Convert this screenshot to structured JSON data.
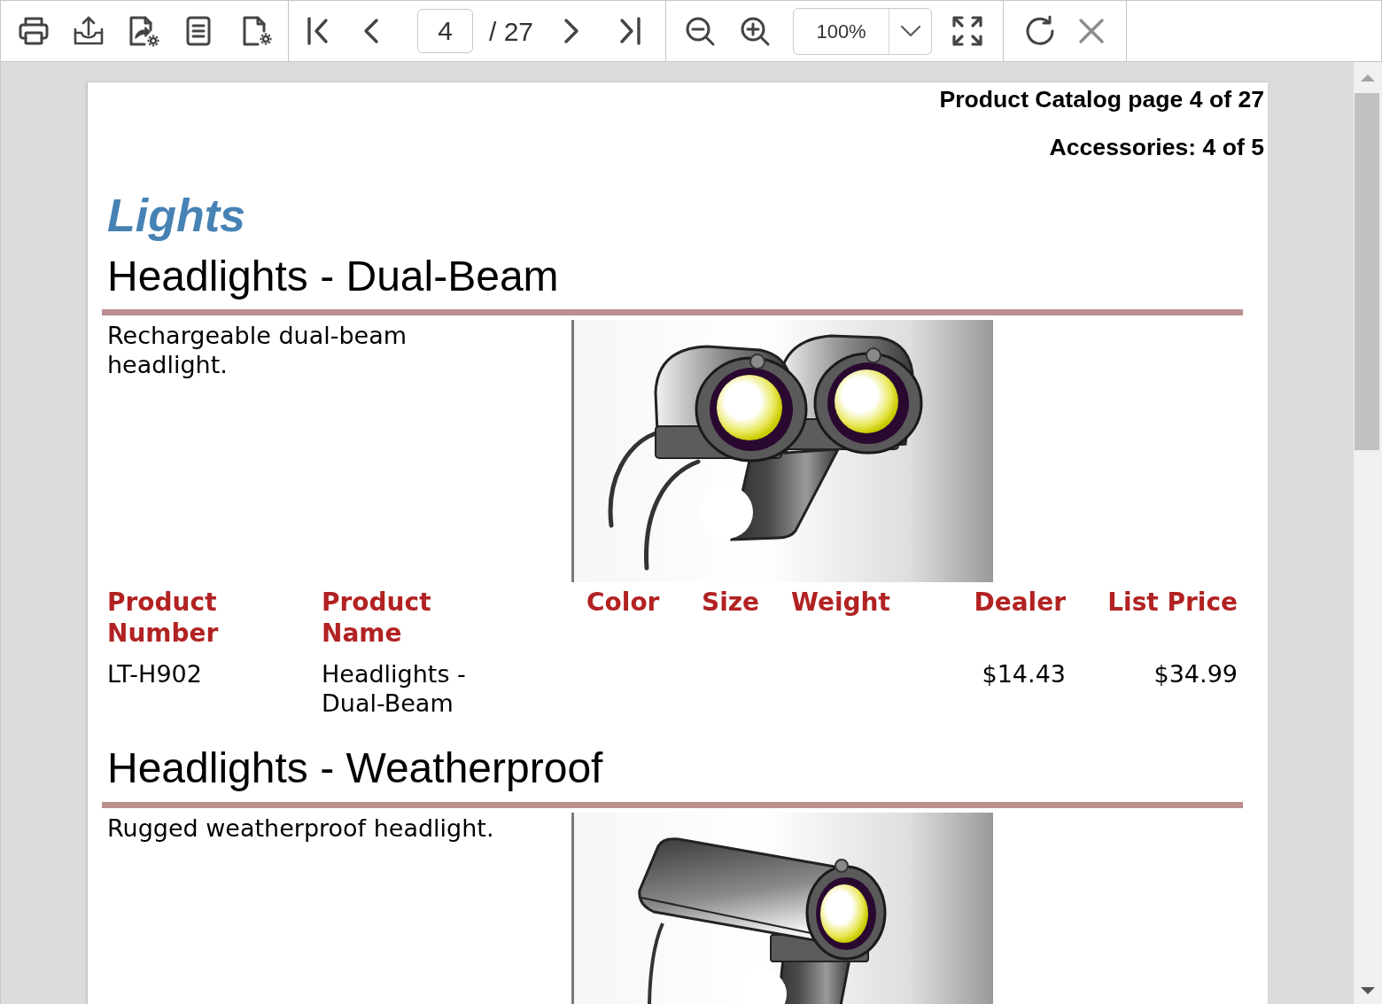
{
  "toolbar": {
    "page_field": {
      "value": "4"
    },
    "page_total": "/ 27",
    "zoom_field": {
      "value": "100%"
    },
    "stop_button": {
      "disabled": true
    }
  },
  "report": {
    "header_lines": [
      "Product Catalog page 4 of 27",
      "Accessories: 4 of 5"
    ],
    "category": "Lights",
    "products": [
      {
        "title": "Headlights - Dual-Beam",
        "description": "Rechargeable dual-beam headlight.",
        "image": {
          "kind": "dual"
        },
        "table": {
          "columns": [
            {
              "label": "Product Number",
              "kind": "text"
            },
            {
              "label": "Product Name",
              "kind": "text"
            },
            {
              "label": "Color",
              "kind": "text"
            },
            {
              "label": "Size",
              "kind": "text"
            },
            {
              "label": "Weight",
              "kind": "text"
            },
            {
              "label": "Dealer",
              "kind": "money"
            },
            {
              "label": "List Price",
              "kind": "money"
            }
          ],
          "rows": [
            {
              "cells": [
                "LT-H902",
                "Headlights - Dual-Beam",
                null,
                null,
                null,
                "$14.43",
                "$34.99"
              ]
            }
          ]
        }
      },
      {
        "title": "Headlights - Weatherproof",
        "description": "Rugged weatherproof headlight.",
        "image": {
          "kind": "single"
        }
      }
    ]
  }
}
